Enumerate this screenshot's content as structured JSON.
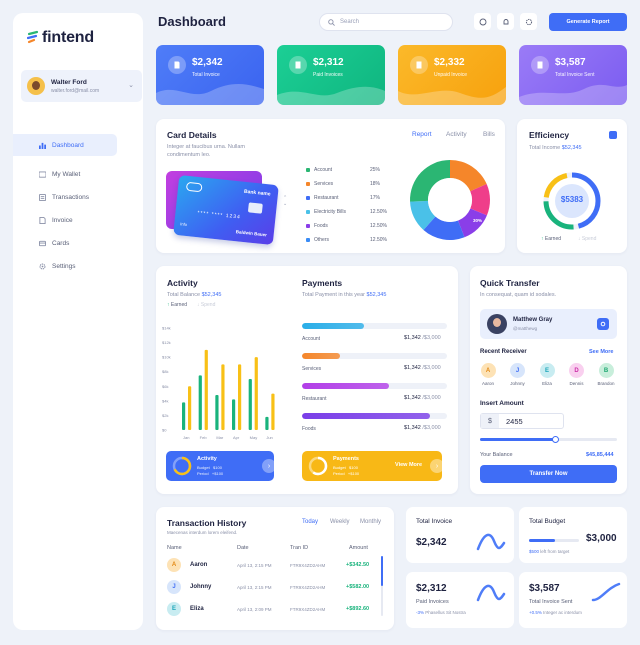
{
  "brand": {
    "name": "fintend"
  },
  "user": {
    "name": "Walter Ford",
    "email": "walter.ford@mail.com"
  },
  "nav": [
    {
      "label": "Dashboard",
      "icon": "bar-chart-icon",
      "active": true
    },
    {
      "label": "My Wallet",
      "icon": "wallet-icon"
    },
    {
      "label": "Transactions",
      "icon": "transactions-icon"
    },
    {
      "label": "Invoice",
      "icon": "invoice-icon"
    },
    {
      "label": "Cards",
      "icon": "card-icon"
    },
    {
      "label": "Settings",
      "icon": "gear-icon"
    }
  ],
  "header": {
    "title": "Dashboard",
    "search_placeholder": "Search",
    "generate_label": "Generate Report"
  },
  "stats": [
    {
      "value": "$2,342",
      "label": "Total Invoice",
      "color": "#3f6df6"
    },
    {
      "value": "$2,312",
      "label": "Paid Invoices",
      "color": "#13c08a"
    },
    {
      "value": "$2,332",
      "label": "Unpaid Invoice",
      "color": "#f8ac16"
    },
    {
      "value": "$3,587",
      "label": "Total Invoice Sent",
      "color": "#8a6cf3"
    }
  ],
  "card_details": {
    "title": "Card Details",
    "desc": "Integer at faucibus urna. Nullam condimentum leo.",
    "tabs": [
      "Report",
      "Activity",
      "Bills"
    ],
    "card_brand": "Bank name",
    "card_number": "**** **** 1234",
    "card_holder": "Baldwin Bauer",
    "card_label": "Info",
    "legend": [
      {
        "name": "Account",
        "pct": "25%",
        "color": "#2bb673"
      },
      {
        "name": "Services",
        "pct": "18%",
        "color": "#f5862a"
      },
      {
        "name": "Restaurant",
        "pct": "17%",
        "color": "#3f6df6"
      },
      {
        "name": "Electricity Bills",
        "pct": "12.50%",
        "color": "#4ac1e8"
      },
      {
        "name": "Foods",
        "pct": "12.50%",
        "color": "#8a3ee8"
      },
      {
        "name": "Others",
        "pct": "12.50%",
        "color": "#3a8cf6"
      }
    ],
    "donut_label": "30%"
  },
  "efficiency": {
    "title": "Efficiency",
    "income_label": "Total Income",
    "income_value": "$52,345",
    "center": "$5383",
    "earned": "Earned",
    "spend": "Spend"
  },
  "activity": {
    "title": "Activity",
    "balance_label": "Total Balance",
    "balance_value": "$52,345",
    "earned": "Earned",
    "spend": "Spend",
    "yticks": [
      "$0",
      "$2k",
      "$4k",
      "$6k",
      "$8k",
      "$10k",
      "$12k",
      "$14k"
    ],
    "footer_title": "Activity",
    "footer_budget": "Budget",
    "footer_budget_val": "$100",
    "footer_period": "Period",
    "footer_period_val": "+$100"
  },
  "chart_data": {
    "type": "bar",
    "categories": [
      "Jan",
      "Feb",
      "Mar",
      "Apr",
      "May",
      "Jun"
    ],
    "series": [
      {
        "name": "Earned",
        "values": [
          3800,
          7500,
          4800,
          4200,
          7000,
          1800
        ],
        "color": "#19b37c"
      },
      {
        "name": "Spend",
        "values": [
          6000,
          11000,
          9000,
          9000,
          10000,
          5000
        ],
        "color": "#f8c016"
      }
    ],
    "ylim": [
      0,
      14000
    ],
    "yticks": [
      "$0",
      "$2k",
      "$4k",
      "$6k",
      "$8k",
      "$10k",
      "$12k",
      "$14k"
    ]
  },
  "payments": {
    "title": "Payments",
    "total_label": "Total Payment in this year",
    "total_value": "$52,345",
    "rows": [
      {
        "label": "Account",
        "value": "$1,342",
        "max": "/$3,000",
        "pct": 0.43,
        "color": "#2aaee8"
      },
      {
        "label": "Services",
        "value": "$1,342",
        "max": "/$3,000",
        "pct": 0.26,
        "color": "#f5862a"
      },
      {
        "label": "Restaurant",
        "value": "$1,342",
        "max": "/$3,000",
        "pct": 0.6,
        "color": "#b23ee8"
      },
      {
        "label": "Foods",
        "value": "$1,342",
        "max": "/$3,000",
        "pct": 0.88,
        "color": "#7a3ee8"
      }
    ],
    "footer_title": "Payments",
    "footer_budget": "Budget",
    "footer_budget_val": "$100",
    "footer_period": "Period",
    "footer_period_val": "+$100",
    "view_more": "View More"
  },
  "quick_transfer": {
    "title": "Quick Transfer",
    "desc": "In consequat, quam id sodales.",
    "contact_name": "Matthew Gray",
    "contact_handle": "@matthewg",
    "recent_label": "Recent Receiver",
    "see_more": "See More",
    "receivers": [
      {
        "initial": "A",
        "name": "Aaron",
        "bg": "#fde2b5",
        "fg": "#e38a16"
      },
      {
        "initial": "J",
        "name": "Johnny",
        "bg": "#d7e5fb",
        "fg": "#3f6df6"
      },
      {
        "initial": "E",
        "name": "Eliza",
        "bg": "#c8ecf1",
        "fg": "#1aa5b8"
      },
      {
        "initial": "D",
        "name": "Dennis",
        "bg": "#f9d0ef",
        "fg": "#cc2aa8"
      },
      {
        "initial": "B",
        "name": "Brandon",
        "bg": "#c8eedb",
        "fg": "#1ea872"
      }
    ],
    "insert_label": "Insert Amount",
    "currency": "$",
    "amount": "2455",
    "slider_pct": 0.55,
    "balance_label": "Your Balance",
    "balance_value": "$45,85,444",
    "button": "Transfer Now"
  },
  "transactions": {
    "title": "Transaction History",
    "desc": "Maecenas interdum lorem eleifend.",
    "tabs": [
      "Today",
      "Weekly",
      "Monthly"
    ],
    "headers": [
      "Name",
      "Date",
      "Tran ID",
      "Amount"
    ],
    "rows": [
      {
        "initial": "A",
        "name": "Aaron",
        "date": "April 13, 2:15 PM",
        "id": "FTR9X4ZD2AHM",
        "amount": "+$342.50",
        "bg": "#fde2b5",
        "fg": "#e38a16"
      },
      {
        "initial": "J",
        "name": "Johnny",
        "date": "April 13, 2:15 PM",
        "id": "FTR9X4ZD2AHM",
        "amount": "+$582.00",
        "bg": "#d7e5fb",
        "fg": "#3f6df6"
      },
      {
        "initial": "E",
        "name": "Eliza",
        "date": "April 13, 2:09 PM",
        "id": "FTR9X4ZD2AHM",
        "amount": "+$892.60",
        "bg": "#c8ecf1",
        "fg": "#1aa5b8"
      }
    ]
  },
  "mini": {
    "total_invoice": {
      "title": "Total Invoice",
      "value": "$2,342"
    },
    "total_budget": {
      "title": "Total  Budget",
      "value": "$3,000",
      "note_val": "$500",
      "note": "left from target",
      "pct": 0.52
    },
    "paid": {
      "value": "$2,312",
      "title": "Paid Invoices",
      "change": "-3%",
      "note": "Phasellus Sit Nostra"
    },
    "sent": {
      "value": "$3,587",
      "title": "Total Invoice Sent",
      "change": "+0.5%",
      "note": "Integer ac interdum"
    }
  }
}
